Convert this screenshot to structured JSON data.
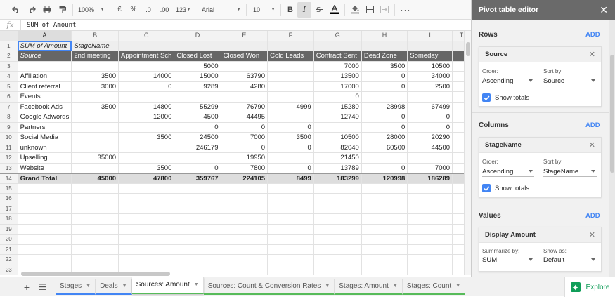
{
  "toolbar": {
    "zoom": "100%",
    "currency": "£",
    "percent": "%",
    "dec_decrease": ".0",
    "dec_increase": ".00",
    "more_formats": "123",
    "font": "Arial",
    "font_size": "10",
    "bold": "B",
    "italic": "I"
  },
  "formula_bar": {
    "fx": "fx",
    "value": "SUM of Amount"
  },
  "grid": {
    "col_letters": [
      "A",
      "B",
      "C",
      "D",
      "E",
      "F",
      "G",
      "H",
      "I"
    ],
    "row_numbers": [
      "1",
      "2",
      "3",
      "4",
      "5",
      "6",
      "7",
      "8",
      "9",
      "10",
      "11",
      "12",
      "13",
      "14",
      "15",
      "16",
      "17",
      "18",
      "19",
      "20",
      "21",
      "22",
      "23"
    ],
    "rows": [
      [
        "SUM of Amount",
        "StageName",
        "",
        "",
        "",
        "",
        "",
        "",
        ""
      ],
      [
        "Source",
        "2nd meeting",
        "Appointment Sch",
        "Closed Lost",
        "Closed Won",
        "Cold Leads",
        "Contract Sent",
        "Dead Zone",
        "Someday"
      ],
      [
        "",
        "",
        "",
        "5000",
        "",
        "",
        "7000",
        "3500",
        "10500"
      ],
      [
        "Affiliation",
        "3500",
        "14000",
        "15000",
        "63790",
        "",
        "13500",
        "0",
        "34000"
      ],
      [
        "Client referral",
        "3000",
        "0",
        "9289",
        "4280",
        "",
        "17000",
        "0",
        "2500"
      ],
      [
        "Events",
        "",
        "",
        "",
        "",
        "",
        "0",
        "",
        ""
      ],
      [
        "Facebook Ads",
        "3500",
        "14800",
        "55299",
        "76790",
        "4999",
        "15280",
        "28998",
        "67499"
      ],
      [
        "Google Adwords",
        "",
        "12000",
        "4500",
        "44495",
        "",
        "12740",
        "0",
        "0"
      ],
      [
        "Partners",
        "",
        "",
        "0",
        "0",
        "0",
        "",
        "0",
        "0"
      ],
      [
        "Social Media",
        "",
        "3500",
        "24500",
        "7000",
        "3500",
        "10500",
        "28000",
        "20290"
      ],
      [
        "unknown",
        "",
        "",
        "246179",
        "0",
        "0",
        "82040",
        "60500",
        "44500"
      ],
      [
        "Upselling",
        "35000",
        "",
        "",
        "19950",
        "",
        "21450",
        "",
        ""
      ],
      [
        "Website",
        "",
        "3500",
        "0",
        "7800",
        "0",
        "13789",
        "0",
        "7000"
      ],
      [
        "Grand Total",
        "45000",
        "47800",
        "359767",
        "224105",
        "8499",
        "183299",
        "120998",
        "186289"
      ],
      [
        "",
        "",
        "",
        "",
        "",
        "",
        "",
        "",
        ""
      ],
      [
        "",
        "",
        "",
        "",
        "",
        "",
        "",
        "",
        ""
      ],
      [
        "",
        "",
        "",
        "",
        "",
        "",
        "",
        "",
        ""
      ],
      [
        "",
        "",
        "",
        "",
        "",
        "",
        "",
        "",
        ""
      ],
      [
        "",
        "",
        "",
        "",
        "",
        "",
        "",
        "",
        ""
      ],
      [
        "",
        "",
        "",
        "",
        "",
        "",
        "",
        "",
        ""
      ],
      [
        "",
        "",
        "",
        "",
        "",
        "",
        "",
        "",
        ""
      ],
      [
        "",
        "",
        "",
        "",
        "",
        "",
        "",
        "",
        ""
      ],
      [
        "",
        "",
        "",
        "",
        "",
        "",
        "",
        "",
        ""
      ]
    ],
    "overflow_col_header": "T"
  },
  "sheet_tabs": [
    {
      "label": "Stages",
      "underline": "blue"
    },
    {
      "label": "Deals",
      "underline": "blue"
    },
    {
      "label": "Sources: Amount",
      "underline": "green",
      "active": true
    },
    {
      "label": "Sources: Count & Conversion Rates",
      "underline": "green"
    },
    {
      "label": "Stages: Amount",
      "underline": "green"
    },
    {
      "label": "Stages: Count",
      "underline": "green"
    }
  ],
  "explore_label": "Explore",
  "pivot": {
    "title": "Pivot table editor",
    "rows": {
      "title": "Rows",
      "add": "ADD",
      "field": "Source",
      "order_label": "Order:",
      "order_value": "Ascending",
      "sortby_label": "Sort by:",
      "sortby_value": "Source",
      "show_totals": "Show totals"
    },
    "columns": {
      "title": "Columns",
      "add": "ADD",
      "field": "StageName",
      "order_label": "Order:",
      "order_value": "Ascending",
      "sortby_label": "Sort by:",
      "sortby_value": "StageName",
      "show_totals": "Show totals"
    },
    "values": {
      "title": "Values",
      "add": "ADD",
      "field": "Display Amount",
      "summarize_label": "Summarize by:",
      "summarize_value": "SUM",
      "showas_label": "Show as:",
      "showas_value": "Default"
    }
  },
  "colors": {
    "accent": "#4285f4",
    "green": "#0f9d58",
    "header_dark": "#666666",
    "panel_head": "#6a6a6a"
  }
}
